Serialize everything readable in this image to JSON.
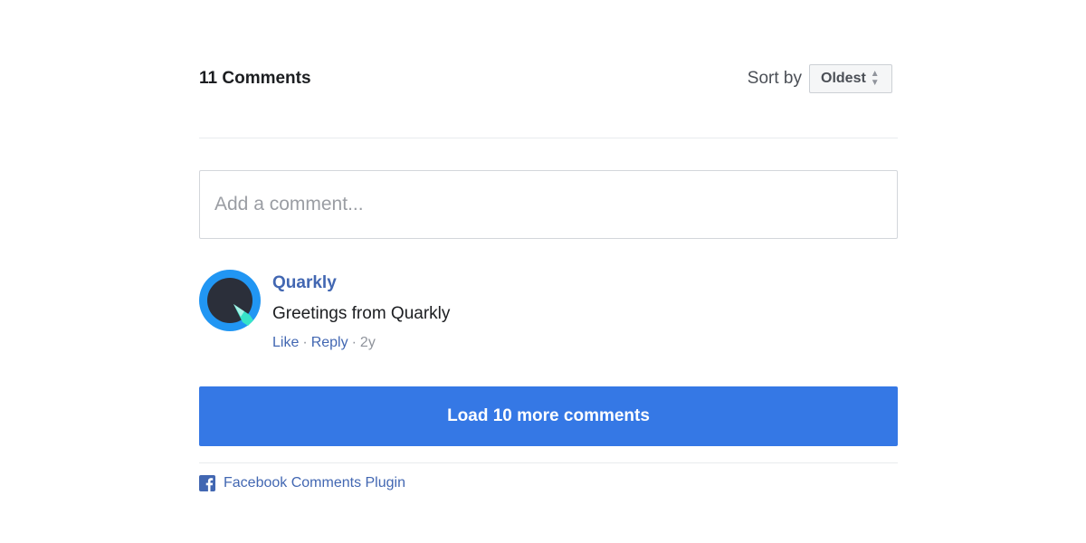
{
  "header": {
    "comment_count": "11 Comments",
    "sort_label": "Sort by",
    "sort_value": "Oldest"
  },
  "composer": {
    "placeholder": "Add a comment..."
  },
  "comments": [
    {
      "author": "Quarkly",
      "text": "Greetings from Quarkly",
      "like": "Like",
      "reply": "Reply",
      "separator": "·",
      "age": "2y",
      "avatar_icon": "quarkly-logo-icon"
    }
  ],
  "load_more": {
    "label": "Load 10 more comments"
  },
  "footer": {
    "icon": "facebook-icon",
    "label": "Facebook Comments Plugin"
  },
  "colors": {
    "link": "#4267b2",
    "button": "#3578e5",
    "avatar_ring": "#2196f3",
    "avatar_core": "#2b2f3a",
    "avatar_accent": "#37e4c8"
  }
}
